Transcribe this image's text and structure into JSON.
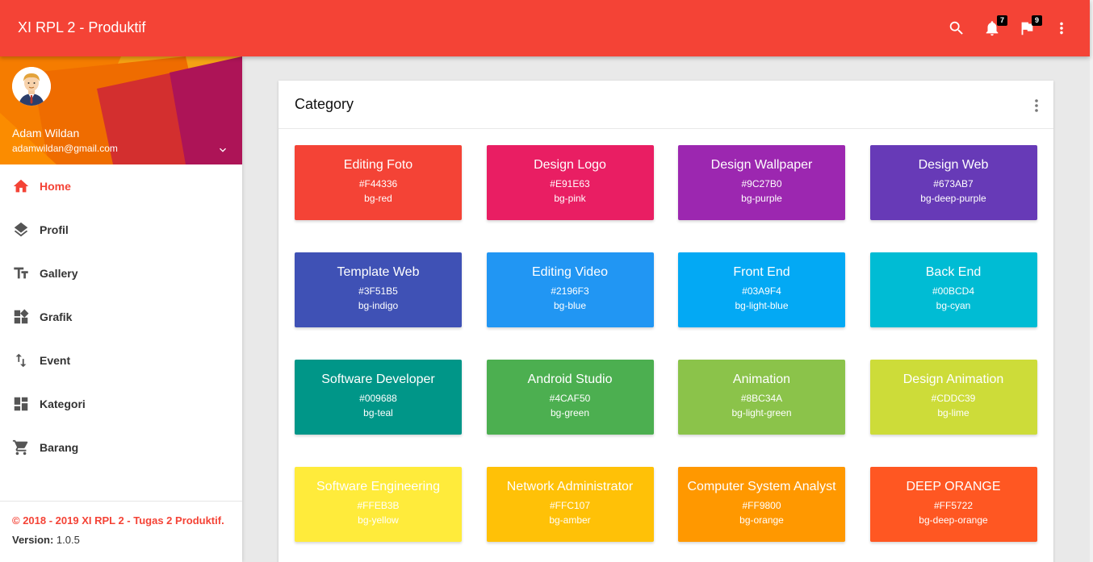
{
  "navbar": {
    "title": "XI RPL 2 - Produktif",
    "notif_count": "7",
    "flag_count": "9",
    "icons": [
      "search-icon",
      "bell-icon",
      "flag-icon",
      "more-vert-icon"
    ]
  },
  "user": {
    "name": "Adam Wildan",
    "email": "adamwildan@gmail.com"
  },
  "menu": [
    {
      "label": "Home",
      "icon": "home-icon",
      "active": true
    },
    {
      "label": "Profil",
      "icon": "layers-icon"
    },
    {
      "label": "Gallery",
      "icon": "text-fields-icon"
    },
    {
      "label": "Grafik",
      "icon": "widgets-icon"
    },
    {
      "label": "Event",
      "icon": "swap-vert-icon"
    },
    {
      "label": "Kategori",
      "icon": "dashboard-icon"
    },
    {
      "label": "Barang",
      "icon": "cart-icon"
    }
  ],
  "legal": {
    "copyright": "© 2018 - 2019 XI RPL 2 - Tugas 2 Produktif.",
    "version_label": "Version: ",
    "version": "1.0.5"
  },
  "card": {
    "title": "Category"
  },
  "tiles": [
    {
      "name": "Editing Foto",
      "hex": "#F44336",
      "cls": "bg-red",
      "color": "#F44336"
    },
    {
      "name": "Design Logo",
      "hex": "#E91E63",
      "cls": "bg-pink",
      "color": "#E91E63"
    },
    {
      "name": "Design Wallpaper",
      "hex": "#9C27B0",
      "cls": "bg-purple",
      "color": "#9C27B0"
    },
    {
      "name": "Design Web",
      "hex": "#673AB7",
      "cls": "bg-deep-purple",
      "color": "#673AB7"
    },
    {
      "name": "Template Web",
      "hex": "#3F51B5",
      "cls": "bg-indigo",
      "color": "#3F51B5"
    },
    {
      "name": "Editing Video",
      "hex": "#2196F3",
      "cls": "bg-blue",
      "color": "#2196F3"
    },
    {
      "name": "Front End",
      "hex": "#03A9F4",
      "cls": "bg-light-blue",
      "color": "#03A9F4"
    },
    {
      "name": "Back End",
      "hex": "#00BCD4",
      "cls": "bg-cyan",
      "color": "#00BCD4"
    },
    {
      "name": "Software Developer",
      "hex": "#009688",
      "cls": "bg-teal",
      "color": "#009688"
    },
    {
      "name": "Android Studio",
      "hex": "#4CAF50",
      "cls": "bg-green",
      "color": "#4CAF50"
    },
    {
      "name": "Animation",
      "hex": "#8BC34A",
      "cls": "bg-light-green",
      "color": "#8BC34A"
    },
    {
      "name": "Design Animation",
      "hex": "#CDDC39",
      "cls": "bg-lime",
      "color": "#CDDC39"
    },
    {
      "name": "Software Engineering",
      "hex": "#FFEB3B",
      "cls": "bg-yellow",
      "color": "#FFEB3B"
    },
    {
      "name": "Network Administrator",
      "hex": "#FFC107",
      "cls": "bg-amber",
      "color": "#FFC107"
    },
    {
      "name": "Computer System Analyst",
      "hex": "#FF9800",
      "cls": "bg-orange",
      "color": "#FF9800"
    },
    {
      "name": "DEEP ORANGE",
      "hex": "#FF5722",
      "cls": "bg-deep-orange",
      "color": "#FF5722"
    }
  ]
}
